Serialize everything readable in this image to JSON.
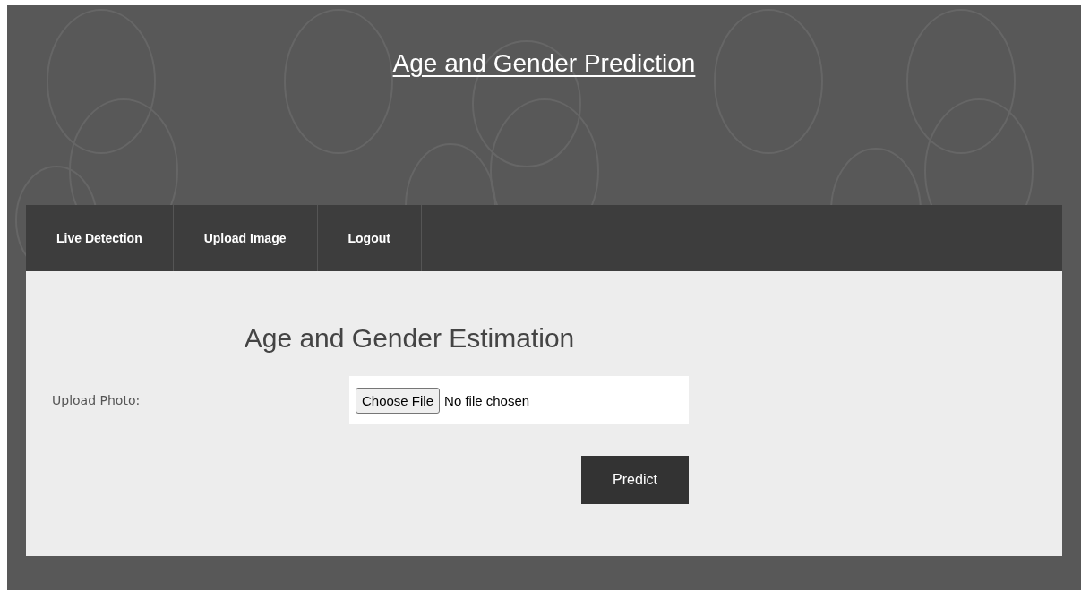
{
  "header": {
    "title": "Age and Gender Prediction"
  },
  "nav": {
    "items": [
      {
        "label": "Live Detection",
        "selected": false
      },
      {
        "label": "Upload Image",
        "selected": false
      },
      {
        "label": "Logout",
        "selected": false
      }
    ]
  },
  "form": {
    "heading": "Age and Gender Estimation",
    "label": "Upload Photo:",
    "file_button": "Choose File",
    "file_status": "No file chosen",
    "submit": "Predict"
  }
}
